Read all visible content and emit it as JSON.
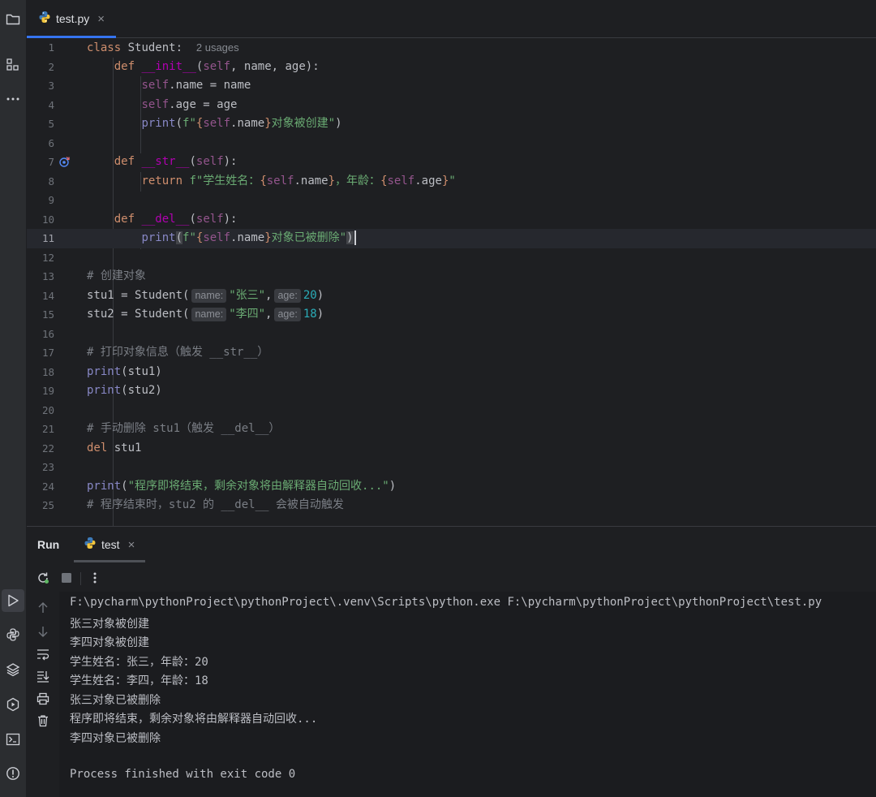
{
  "editor_tab": {
    "filename": "test.py",
    "close": "×"
  },
  "code_lines": [
    {
      "n": "1"
    },
    {
      "n": "2"
    },
    {
      "n": "3"
    },
    {
      "n": "4"
    },
    {
      "n": "5"
    },
    {
      "n": "6"
    },
    {
      "n": "7"
    },
    {
      "n": "8"
    },
    {
      "n": "9"
    },
    {
      "n": "10"
    },
    {
      "n": "11"
    },
    {
      "n": "12"
    },
    {
      "n": "13"
    },
    {
      "n": "14"
    },
    {
      "n": "15"
    },
    {
      "n": "16"
    },
    {
      "n": "17"
    },
    {
      "n": "18"
    },
    {
      "n": "19"
    },
    {
      "n": "20"
    },
    {
      "n": "21"
    },
    {
      "n": "22"
    },
    {
      "n": "23"
    },
    {
      "n": "24"
    },
    {
      "n": "25"
    }
  ],
  "code": {
    "l1": {
      "kw": "class",
      "name": " Student:",
      "hint": "2 usages"
    },
    "l2": {
      "kw": "def",
      "fn": "__init__",
      "open": "(",
      "self": "self",
      "rest": ", name, age):"
    },
    "l3": {
      "self": "self",
      "rest": ".name = name"
    },
    "l4": {
      "self": "self",
      "rest": ".age = age"
    },
    "l5": {
      "bi": "print",
      "open": "(",
      "f": "f\"",
      "b1": "{",
      "self": "self",
      "attr": ".name",
      "b2": "}",
      "s": "对象被创建\"",
      "close": ")"
    },
    "l7": {
      "kw": "def",
      "fn": "__str__",
      "open": "(",
      "self": "self",
      "rest": "):"
    },
    "l8": {
      "kw": "return",
      "f": "f\"学生姓名：",
      "b1": "{",
      "self1": "self",
      "attr1": ".name",
      "b2": "}",
      "mid": "，年龄：",
      "b3": "{",
      "self2": "self",
      "attr2": ".age",
      "b4": "}",
      "end": "\""
    },
    "l10": {
      "kw": "def",
      "fn": "__del__",
      "open": "(",
      "self": "self",
      "rest": "):"
    },
    "l11": {
      "bi": "print",
      "open": "(",
      "f": "f\"",
      "b1": "{",
      "self": "self",
      "attr": ".name",
      "b2": "}",
      "s": "对象已被删除\"",
      "close": ")"
    },
    "l13": {
      "cmt": "# 创建对象"
    },
    "l14": {
      "pre": "stu1 = Student(",
      "h1": "name:",
      "s": "\"张三\"",
      "comma": ",",
      "h2": "age:",
      "num": "20",
      "close": ")"
    },
    "l15": {
      "pre": "stu2 = Student(",
      "h1": "name:",
      "s": "\"李四\"",
      "comma": ",",
      "h2": "age:",
      "num": "18",
      "close": ")"
    },
    "l17": {
      "cmt": "# 打印对象信息（触发 __str__）"
    },
    "l18": {
      "bi": "print",
      "rest": "(stu1)"
    },
    "l19": {
      "bi": "print",
      "rest": "(stu2)"
    },
    "l21": {
      "cmt": "# 手动删除 stu1（触发 __del__）"
    },
    "l22": {
      "kw": "del",
      "rest": " stu1"
    },
    "l24": {
      "bi": "print",
      "open": "(",
      "s": "\"程序即将结束，剩余对象将由解释器自动回收...\"",
      "close": ")"
    },
    "l25": {
      "cmt": "# 程序结束时，stu2 的 __del__ 会被自动触发"
    }
  },
  "run_panel": {
    "title": "Run",
    "tab_label": "test",
    "close": "×",
    "output": [
      "F:\\pycharm\\pythonProject\\pythonProject\\.venv\\Scripts\\python.exe F:\\pycharm\\pythonProject\\pythonProject\\test.py",
      "张三对象被创建",
      "李四对象被创建",
      "学生姓名：张三，年龄：20",
      "学生姓名：李四，年龄：18",
      "张三对象已被删除",
      "程序即将结束，剩余对象将由解释器自动回收...",
      "李四对象已被删除",
      "",
      "Process finished with exit code 0"
    ]
  },
  "colors": {
    "background": "#1e1f22",
    "keyword": "#cf8e6d",
    "function": "#56a8f5",
    "self": "#94558d",
    "string": "#6aab73",
    "number": "#2aacb8",
    "comment": "#7a7e85",
    "accent": "#3574f0"
  },
  "icons": {
    "leftbar": [
      "folder-icon",
      "structure-icon",
      "more-icon",
      "run-icon",
      "python-console-icon",
      "layers-icon",
      "services-icon",
      "terminal-icon",
      "problems-icon"
    ],
    "run_toolbar": [
      "rerun-icon",
      "stop-icon",
      "kebab-menu-icon"
    ],
    "run_sidebar": [
      "arrow-up-icon",
      "arrow-down-icon",
      "soft-wrap-icon",
      "scroll-to-end-icon",
      "print-icon",
      "trash-icon"
    ]
  }
}
